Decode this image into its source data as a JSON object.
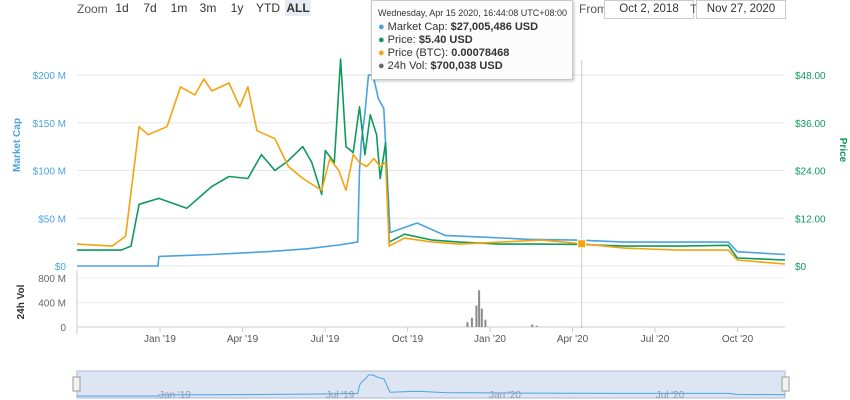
{
  "toolbar": {
    "zoom_label": "Zoom",
    "zoom_buttons": [
      "1d",
      "7d",
      "1m",
      "3m",
      "1y",
      "YTD",
      "ALL"
    ],
    "active_zoom": "ALL",
    "from_label": "From",
    "from_value": "Oct 2, 2018",
    "to_label": "To",
    "to_value": "Nov 27, 2020"
  },
  "tooltip": {
    "date": "Wednesday, Apr 15 2020, 16:44:08 UTC+08:00",
    "rows": [
      {
        "label": "Market Cap:",
        "value": "$27,005,486 USD",
        "color": "#4aa3df"
      },
      {
        "label": "Price:",
        "value": "$5.40 USD",
        "color": "#0f9a5b"
      },
      {
        "label": "Price (BTC):",
        "value": "0.00078468",
        "color": "#f5a30e"
      },
      {
        "label": "24h Vol:",
        "value": "$700,038 USD",
        "color": "#6b6b6b"
      }
    ]
  },
  "colors": {
    "market_cap": "#4aa3df",
    "price_usd": "#0f9a5b",
    "price_btc": "#f5a30e",
    "volume": "#8a8a8a",
    "navigator_fill": "#c7d3eb"
  },
  "chart_data": [
    {
      "type": "line",
      "x_axis_labels": [
        "Jan '19",
        "Apr '19",
        "Jul '19",
        "Oct '19",
        "Jan '20",
        "Apr '20",
        "Jul '20",
        "Oct '20"
      ],
      "x_range": [
        "2018-10-02",
        "2020-11-27"
      ],
      "left_axis": {
        "label": "Market Cap",
        "ticks": [
          "$0",
          "$50 M",
          "$100 M",
          "$150 M",
          "$200 M"
        ],
        "range": [
          0,
          200000000
        ]
      },
      "right_axis": {
        "label": "Price",
        "ticks": [
          "$0",
          "$12.00",
          "$24.00",
          "$36.00",
          "$48.00"
        ],
        "range": [
          0,
          48
        ]
      },
      "grid": true,
      "crosshair_date": "2020-04-15",
      "series": [
        {
          "name": "Market Cap",
          "axis": "left",
          "points": [
            [
              "2018-10-02",
              0
            ],
            [
              "2018-12-31",
              0
            ],
            [
              "2019-01-01",
              10000000
            ],
            [
              "2019-03-01",
              12000000
            ],
            [
              "2019-05-01",
              15000000
            ],
            [
              "2019-06-15",
              18000000
            ],
            [
              "2019-07-20",
              22000000
            ],
            [
              "2019-08-10",
              25000000
            ],
            [
              "2019-08-12",
              100000000
            ],
            [
              "2019-08-14",
              130000000
            ],
            [
              "2019-08-18",
              160000000
            ],
            [
              "2019-08-22",
              200000000
            ],
            [
              "2019-08-27",
              200000000
            ],
            [
              "2019-09-02",
              175000000
            ],
            [
              "2019-09-08",
              165000000
            ],
            [
              "2019-09-15",
              35000000
            ],
            [
              "2019-10-15",
              45000000
            ],
            [
              "2019-11-15",
              32000000
            ],
            [
              "2020-01-01",
              30000000
            ],
            [
              "2020-02-15",
              28000000
            ],
            [
              "2020-04-15",
              27005486
            ],
            [
              "2020-06-01",
              25000000
            ],
            [
              "2020-08-01",
              25000000
            ],
            [
              "2020-09-25",
              25000000
            ],
            [
              "2020-10-05",
              15000000
            ],
            [
              "2020-11-27",
              12000000
            ]
          ]
        },
        {
          "name": "Price",
          "axis": "right",
          "points": [
            [
              "2018-10-02",
              4.0
            ],
            [
              "2018-11-20",
              4.0
            ],
            [
              "2018-12-01",
              5.0
            ],
            [
              "2018-12-10",
              15.5
            ],
            [
              "2019-01-01",
              17.0
            ],
            [
              "2019-02-01",
              14.5
            ],
            [
              "2019-03-01",
              20.0
            ],
            [
              "2019-03-20",
              22.5
            ],
            [
              "2019-04-10",
              22.0
            ],
            [
              "2019-04-25",
              28.0
            ],
            [
              "2019-05-10",
              24.0
            ],
            [
              "2019-05-25",
              26.5
            ],
            [
              "2019-06-10",
              30.0
            ],
            [
              "2019-06-20",
              26.0
            ],
            [
              "2019-07-01",
              18.0
            ],
            [
              "2019-07-05",
              29.0
            ],
            [
              "2019-07-15",
              26.0
            ],
            [
              "2019-07-22",
              52.0
            ],
            [
              "2019-07-28",
              30.0
            ],
            [
              "2019-08-05",
              28.5
            ],
            [
              "2019-08-12",
              40.0
            ],
            [
              "2019-08-18",
              28.0
            ],
            [
              "2019-08-24",
              38.0
            ],
            [
              "2019-08-31",
              33.0
            ],
            [
              "2019-09-04",
              22.0
            ],
            [
              "2019-09-10",
              31.0
            ],
            [
              "2019-09-14",
              6.0
            ],
            [
              "2019-10-01",
              8.0
            ],
            [
              "2019-11-01",
              6.5
            ],
            [
              "2019-12-01",
              6.0
            ],
            [
              "2020-01-15",
              5.5
            ],
            [
              "2020-03-01",
              5.5
            ],
            [
              "2020-04-15",
              5.4
            ],
            [
              "2020-06-01",
              5.0
            ],
            [
              "2020-08-01",
              5.0
            ],
            [
              "2020-09-25",
              5.2
            ],
            [
              "2020-10-05",
              2.0
            ],
            [
              "2020-11-27",
              1.5
            ]
          ]
        },
        {
          "name": "Price (BTC)",
          "axis": "right",
          "points": [
            [
              "2018-10-02",
              5.5
            ],
            [
              "2018-11-10",
              5.0
            ],
            [
              "2018-11-25",
              7.5
            ],
            [
              "2018-12-10",
              35.0
            ],
            [
              "2018-12-20",
              33.0
            ],
            [
              "2019-01-10",
              35.0
            ],
            [
              "2019-01-25",
              45.0
            ],
            [
              "2019-02-10",
              43.0
            ],
            [
              "2019-02-20",
              47.0
            ],
            [
              "2019-03-01",
              44.0
            ],
            [
              "2019-03-20",
              46.0
            ],
            [
              "2019-04-01",
              40.0
            ],
            [
              "2019-04-10",
              45.0
            ],
            [
              "2019-04-20",
              34.0
            ],
            [
              "2019-05-10",
              32.0
            ],
            [
              "2019-05-25",
              25.0
            ],
            [
              "2019-06-10",
              22.0
            ],
            [
              "2019-07-01",
              19.0
            ],
            [
              "2019-07-10",
              27.0
            ],
            [
              "2019-07-20",
              24.0
            ],
            [
              "2019-07-28",
              19.0
            ],
            [
              "2019-08-05",
              28.0
            ],
            [
              "2019-08-12",
              26.0
            ],
            [
              "2019-08-20",
              25.0
            ],
            [
              "2019-08-28",
              27.0
            ],
            [
              "2019-09-04",
              25.0
            ],
            [
              "2019-09-10",
              26.0
            ],
            [
              "2019-09-14",
              5.0
            ],
            [
              "2019-10-01",
              7.0
            ],
            [
              "2019-11-01",
              6.0
            ],
            [
              "2019-12-01",
              5.5
            ],
            [
              "2020-01-15",
              6.0
            ],
            [
              "2020-03-01",
              6.5
            ],
            [
              "2020-04-15",
              5.6
            ],
            [
              "2020-06-01",
              4.5
            ],
            [
              "2020-08-01",
              4.0
            ],
            [
              "2020-09-25",
              4.0
            ],
            [
              "2020-10-05",
              1.5
            ],
            [
              "2020-11-27",
              0.5
            ]
          ]
        }
      ]
    },
    {
      "type": "bar",
      "name": "24h Vol",
      "y_axis": {
        "label": "24h Vol",
        "ticks": [
          "0",
          "400 M",
          "800 M"
        ],
        "range": [
          0,
          800000000
        ]
      },
      "grid": true,
      "points": [
        [
          "2019-12-10",
          80000000
        ],
        [
          "2019-12-15",
          150000000
        ],
        [
          "2019-12-20",
          350000000
        ],
        [
          "2019-12-23",
          600000000
        ],
        [
          "2019-12-26",
          300000000
        ],
        [
          "2019-12-30",
          120000000
        ],
        [
          "2020-02-20",
          40000000
        ],
        [
          "2020-02-25",
          20000000
        ],
        [
          "2020-04-15",
          700038
        ]
      ]
    },
    {
      "type": "area",
      "name": "navigator",
      "x_axis_labels": [
        "Jan '19",
        "Jul '19",
        "Jan '20",
        "Jul '20"
      ],
      "uses_series": "Market Cap"
    }
  ]
}
